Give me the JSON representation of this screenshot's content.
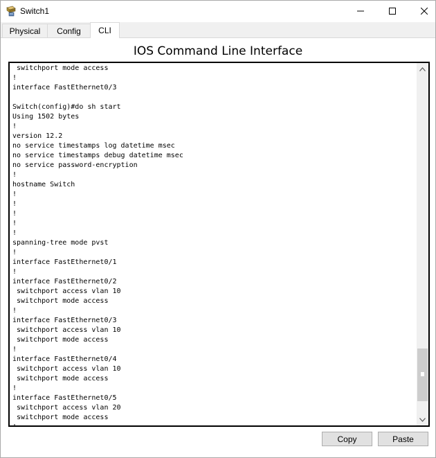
{
  "window": {
    "title": "Switch1",
    "app_icon": "packet-tracer-switch-icon"
  },
  "tabs": [
    {
      "label": "Physical",
      "active": false
    },
    {
      "label": "Config",
      "active": false
    },
    {
      "label": "CLI",
      "active": true
    }
  ],
  "main": {
    "heading": "IOS Command Line Interface"
  },
  "console": {
    "lines": [
      " switchport mode access",
      "!",
      "interface FastEthernet0/3",
      "",
      "Switch(config)#do sh start",
      "Using 1502 bytes",
      "!",
      "version 12.2",
      "no service timestamps log datetime msec",
      "no service timestamps debug datetime msec",
      "no service password-encryption",
      "!",
      "hostname Switch",
      "!",
      "!",
      "!",
      "!",
      "!",
      "spanning-tree mode pvst",
      "!",
      "interface FastEthernet0/1",
      "!",
      "interface FastEthernet0/2",
      " switchport access vlan 10",
      " switchport mode access",
      "!",
      "interface FastEthernet0/3",
      " switchport access vlan 10",
      " switchport mode access",
      "!",
      "interface FastEthernet0/4",
      " switchport access vlan 10",
      " switchport mode access",
      "!",
      "interface FastEthernet0/5",
      " switchport access vlan 20",
      " switchport mode access",
      "!"
    ]
  },
  "buttons": {
    "copy": "Copy",
    "paste": "Paste"
  },
  "colors": {
    "window_bg": "#ffffff",
    "tab_bg": "#f0f0f0",
    "console_border": "#000000",
    "button_bg": "#e1e1e1"
  }
}
